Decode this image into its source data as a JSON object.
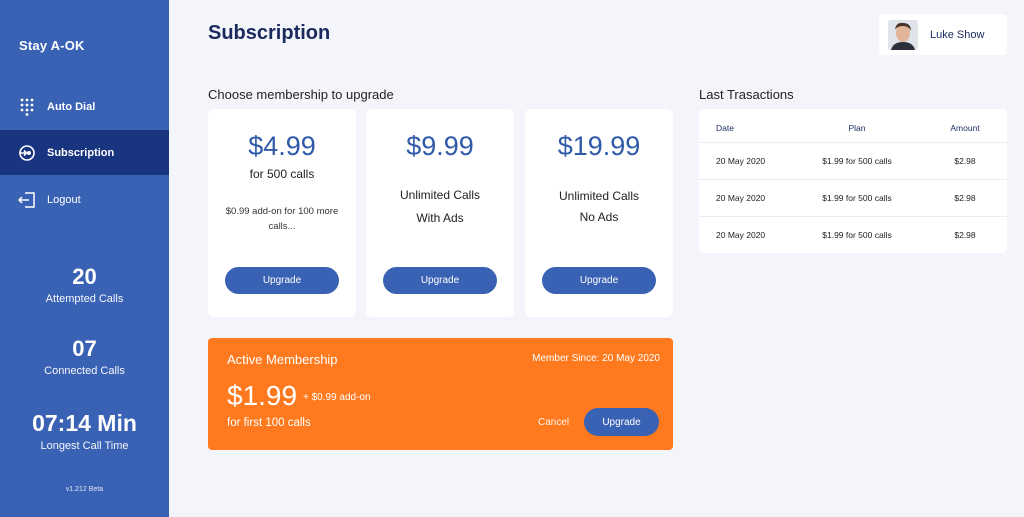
{
  "sidebar": {
    "brand": "Stay A-OK",
    "nav": [
      {
        "label": "Auto Dial",
        "icon": "dialpad-icon"
      },
      {
        "label": "Subscription",
        "icon": "subscription-icon"
      },
      {
        "label": "Logout",
        "icon": "logout-icon"
      }
    ],
    "stats": [
      {
        "value": "20",
        "caption": "Attempted Calls"
      },
      {
        "value": "07",
        "caption": "Connected Calls"
      },
      {
        "value": "07:14 Min",
        "caption": "Longest Call Time"
      }
    ],
    "version": "v1.212 Beta"
  },
  "header": {
    "title": "Subscription",
    "user_name": "Luke Show"
  },
  "plans": {
    "label": "Choose membership to upgrade",
    "items": [
      {
        "price": "$4.99",
        "line1": "for 500 calls",
        "line2": "",
        "note": "$0.99 add-on for 100 more calls...",
        "button": "Upgrade"
      },
      {
        "price": "$9.99",
        "line1": "Unlimited Calls",
        "line2": "With Ads",
        "note": "",
        "button": "Upgrade"
      },
      {
        "price": "$19.99",
        "line1": "Unlimited Calls",
        "line2": "No Ads",
        "note": "",
        "button": "Upgrade"
      }
    ]
  },
  "active": {
    "title": "Active Membership",
    "member_since": "Member Since:  20 May 2020",
    "price": "$1.99",
    "addon": "+ $0.99 add-on",
    "calls": "for first 100 calls",
    "cancel": "Cancel",
    "upgrade": "Upgrade"
  },
  "transactions": {
    "label": "Last Trasactions",
    "columns": [
      "Date",
      "Plan",
      "Amount"
    ],
    "rows": [
      {
        "date": "20 May 2020",
        "plan": "$1.99 for 500 calls",
        "amount": "$2.98"
      },
      {
        "date": "20 May 2020",
        "plan": "$1.99 for 500 calls",
        "amount": "$2.98"
      },
      {
        "date": "20 May 2020",
        "plan": "$1.99 for 500 calls",
        "amount": "$2.98"
      }
    ]
  },
  "colors": {
    "sidebar": "#3a62b4",
    "sidebar_active": "#1a3580",
    "accent": "#ff7a1e",
    "button": "#3a62b4"
  }
}
